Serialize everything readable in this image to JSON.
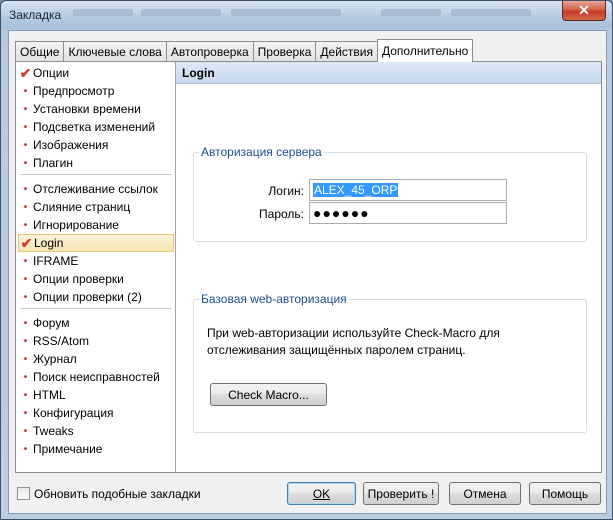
{
  "window": {
    "title": "Закладка",
    "close_glyph": "✕"
  },
  "tabs": [
    {
      "label": "Общие"
    },
    {
      "label": "Ключевые слова"
    },
    {
      "label": "Автопроверка"
    },
    {
      "label": "Проверка"
    },
    {
      "label": "Действия"
    },
    {
      "label": "Дополнительно",
      "active": true
    }
  ],
  "nav": {
    "group1": [
      "Опции",
      "Предпросмотр",
      "Установки времени",
      "Подсветка изменений",
      "Изображения",
      "Плагин"
    ],
    "group2": [
      "Отслеживание ссылок",
      "Слияние страниц",
      "Игнорирование",
      "Login",
      "IFRAME",
      "Опции проверки",
      "Опции проверки (2)"
    ],
    "group3": [
      "Форум",
      "RSS/Atom",
      "Журнал",
      "Поиск неисправностей",
      "HTML",
      "Конфигурация",
      "Tweaks",
      "Примечание"
    ],
    "selected": "Login",
    "check_icon": "check-icon",
    "bullet_glyph": "•",
    "check_glyph": "✔"
  },
  "pane": {
    "header": "Login",
    "server_group": {
      "title": "Авторизация сервера",
      "login_label": "Логин:",
      "login_value": "ALEX_45_ORP",
      "password_label": "Пароль:",
      "password_value": "●●●●●●"
    },
    "web_group": {
      "title": "Базовая web-авторизация",
      "description_line1": "При web-авторизации используйте Check-Macro для",
      "description_line2": "отслеживания защищённых паролем страниц.",
      "button_label": "Check Macro..."
    }
  },
  "bottom": {
    "update_similar_label": "Обновить подобные закладки",
    "update_similar_checked": false,
    "ok_label": "OK",
    "check_label": "Проверить !",
    "cancel_label": "Отмена",
    "help_label": "Помощь"
  },
  "colors": {
    "accent_header": "#c6d8ef",
    "group_title": "#1e4f8c",
    "check_mark": "#d43a2e",
    "selection": "#3399ff"
  }
}
